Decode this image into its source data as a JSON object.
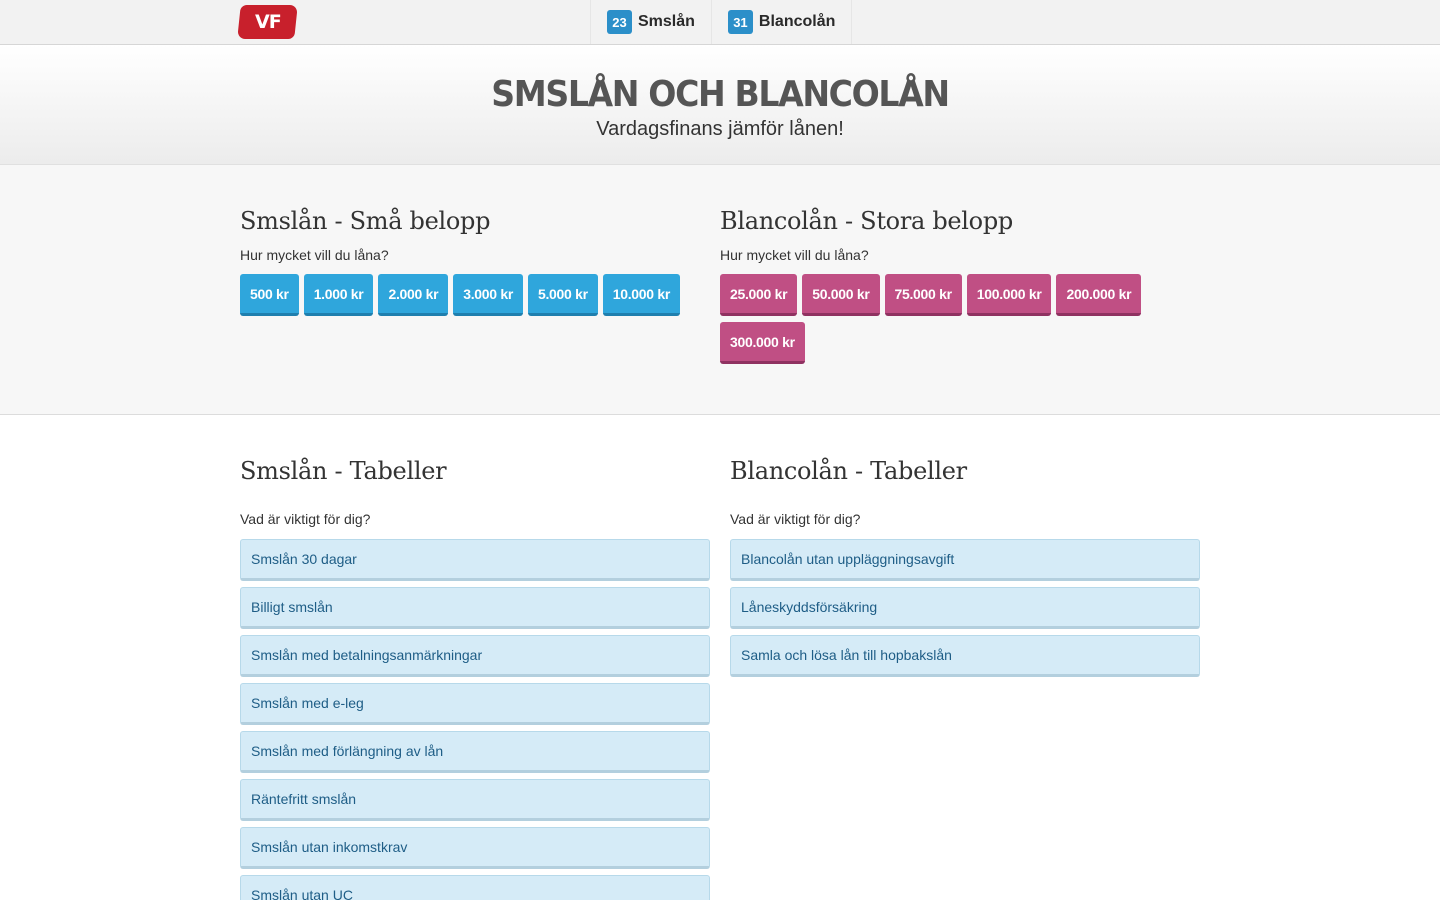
{
  "nav": {
    "logo": "VF",
    "links": [
      {
        "badge": "23",
        "label": "Smslån"
      },
      {
        "badge": "31",
        "label": "Blancolån"
      }
    ]
  },
  "hero": {
    "title": "SMSLÅN OCH BLANCOLÅN",
    "subtitle": "Vardagsfinans jämför lånen!"
  },
  "amount": {
    "sms": {
      "heading": "Smslån - Små belopp",
      "question": "Hur mycket vill du låna?",
      "buttons": [
        "500 kr",
        "1.000 kr",
        "2.000 kr",
        "3.000 kr",
        "5.000 kr",
        "10.000 kr"
      ]
    },
    "blanco": {
      "heading": "Blancolån - Stora belopp",
      "question": "Hur mycket vill du låna?",
      "buttons": [
        "25.000 kr",
        "50.000 kr",
        "75.000 kr",
        "100.000 kr",
        "200.000 kr",
        "300.000 kr"
      ]
    }
  },
  "tables": {
    "sms": {
      "heading": "Smslån - Tabeller",
      "question": "Vad är viktigt för dig?",
      "links": [
        "Smslån 30 dagar",
        "Billigt smslån",
        "Smslån med betalningsanmärkningar",
        "Smslån med e-leg",
        "Smslån med förlängning av lån",
        "Räntefritt smslån",
        "Smslån utan inkomstkrav",
        "Smslån utan UC"
      ]
    },
    "blanco": {
      "heading": "Blancolån - Tabeller",
      "question": "Vad är viktigt för dig?",
      "links": [
        "Blancolån utan uppläggningsavgift",
        "Låneskyddsförsäkring",
        "Samla och lösa lån till hopbakslån"
      ]
    }
  },
  "colors": {
    "brand_red": "#c8202c",
    "badge_blue": "#2b8fc9",
    "sms_button": "#2fa6dc",
    "blanco_button": "#c04f84",
    "link_item_bg": "#d5ebf7"
  }
}
